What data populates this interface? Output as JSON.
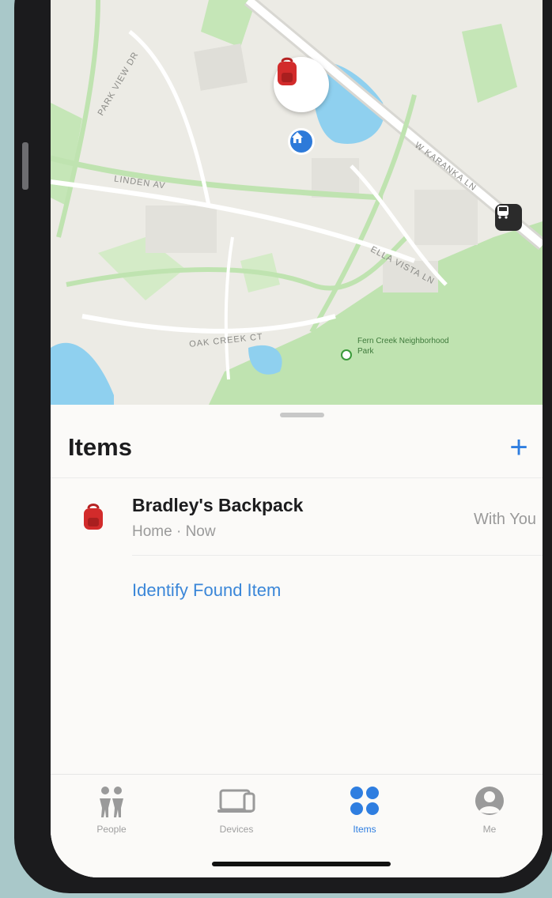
{
  "colors": {
    "accent": "#2f7ee0",
    "item_red": "#d22b2b",
    "park_green": "#bfe3b0",
    "water_blue": "#8fd0ef"
  },
  "map": {
    "street_labels": [
      "W KARANKA LN",
      "LINDEN AV",
      "PARK VIEW DR",
      "ELLA VISTA LN",
      "OAK CREEK CT"
    ],
    "poi_name": "Fern Creek Neighborhood Park",
    "pin_icon": "backpack-icon",
    "home_icon": "house-icon",
    "transit_icon": "bus-icon"
  },
  "sheet": {
    "title": "Items",
    "add_label": "+",
    "items": [
      {
        "name": "Bradley's Backpack",
        "subtitle": "Home · Now",
        "status": "With You",
        "icon": "backpack-icon"
      }
    ],
    "identify_label": "Identify Found Item"
  },
  "tabbar": {
    "tabs": [
      {
        "label": "People",
        "icon": "people-icon",
        "active": false
      },
      {
        "label": "Devices",
        "icon": "devices-icon",
        "active": false
      },
      {
        "label": "Items",
        "icon": "items-grid-icon",
        "active": true
      },
      {
        "label": "Me",
        "icon": "me-icon",
        "active": false
      }
    ]
  }
}
